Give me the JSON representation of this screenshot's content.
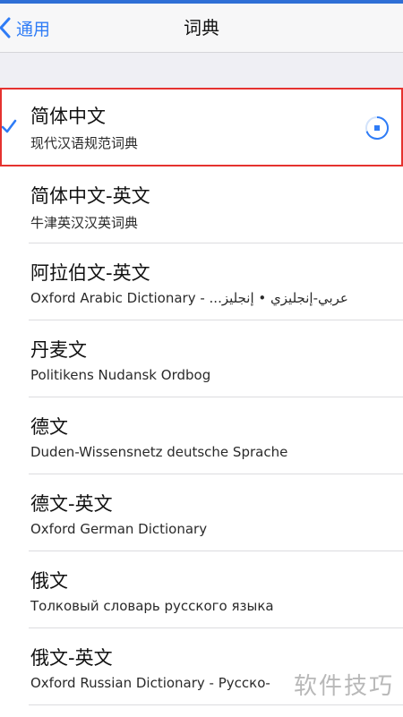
{
  "nav": {
    "back_label": "通用",
    "title": "词典"
  },
  "dictionaries": [
    {
      "title": "简体中文",
      "subtitle": "现代汉语规范词典",
      "selected": true,
      "status": "downloading"
    },
    {
      "title": "简体中文-英文",
      "subtitle": "牛津英汉汉英词典"
    },
    {
      "title": "阿拉伯文-英文",
      "subtitle": "Oxford Arabic Dictionary - ...عربي-إنجليزي • إنجليز"
    },
    {
      "title": "丹麦文",
      "subtitle": "Politikens Nudansk Ordbog"
    },
    {
      "title": "德文",
      "subtitle": "Duden-Wissensnetz deutsche Sprache"
    },
    {
      "title": "德文-英文",
      "subtitle": "Oxford German Dictionary"
    },
    {
      "title": "俄文",
      "subtitle": "Толковый словарь русского языка"
    },
    {
      "title": "俄文-英文",
      "subtitle": "Oxford Russian Dictionary - Русско-"
    }
  ],
  "watermark": "软件技巧",
  "colors": {
    "accent": "#2f7cf6",
    "selection_outline": "#e5322f",
    "top_strip": "#2f6fd6"
  },
  "icons": {
    "back": "chevron-left-icon",
    "selected": "checkmark-icon",
    "download": "download-progress-icon"
  }
}
